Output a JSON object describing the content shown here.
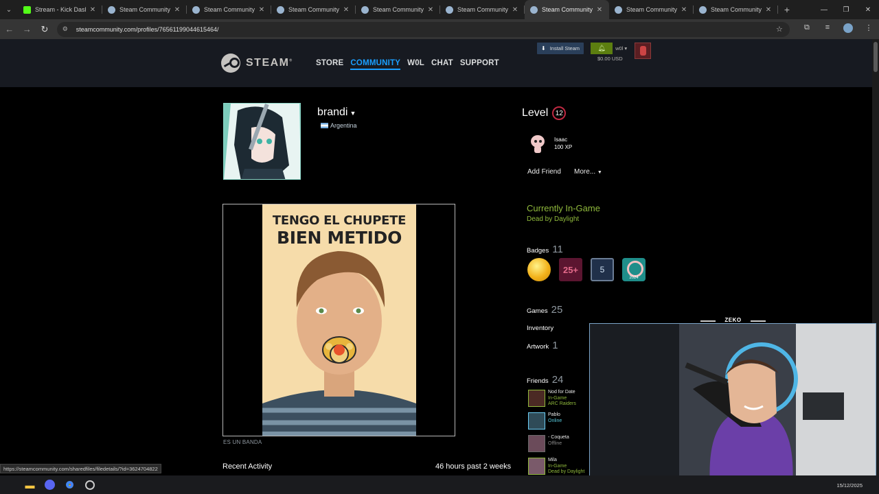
{
  "browser": {
    "tabs": [
      {
        "title": "Stream - Kick Dashbo",
        "icon": "kick-icon"
      },
      {
        "title": "Steam Community ::",
        "icon": "steam-icon"
      },
      {
        "title": "Steam Community ::",
        "icon": "steam-icon"
      },
      {
        "title": "Steam Community ::",
        "icon": "steam-icon"
      },
      {
        "title": "Steam Community ::",
        "icon": "steam-icon"
      },
      {
        "title": "Steam Community ::",
        "icon": "steam-icon"
      },
      {
        "title": "Steam Community ::",
        "icon": "steam-icon",
        "active": true
      },
      {
        "title": "Steam Community ::",
        "icon": "steam-icon"
      },
      {
        "title": "Steam Community ::",
        "icon": "steam-icon"
      }
    ],
    "url": "steamcommunity.com/profiles/76561199044615464/",
    "status_url": "https://steamcommunity.com/sharedfiles/filedetails/?id=3624704822"
  },
  "steam_header": {
    "logo_text": "STEAM",
    "nav": [
      "STORE",
      "COMMUNITY",
      "W0L",
      "CHAT",
      "SUPPORT"
    ],
    "active_nav": "COMMUNITY",
    "install_label": "Install Steam",
    "account_name": "w0l",
    "wallet": "$0.00 USD"
  },
  "profile": {
    "persona_name": "brandi",
    "country": "Argentina",
    "level_label": "Level",
    "level": "12",
    "favorite_badge": {
      "name": "Isaac",
      "xp": "100 XP"
    },
    "add_friend_label": "Add Friend",
    "more_label": "More...",
    "showcase": {
      "poster_line1": "TENGO EL CHUPETE",
      "poster_line2": "BIEN METIDO",
      "caption": "ES UN BANDA"
    },
    "status_title": "Currently In-Game",
    "status_game": "Dead by Daylight",
    "badges_label": "Badges",
    "badges_count": "11",
    "badge_icons": [
      "25+",
      "5",
      "2024"
    ],
    "games_label": "Games",
    "games_count": "25",
    "inventory_label": "Inventory",
    "artwork_label": "Artwork",
    "artwork_count": "1",
    "friends_label": "Friends",
    "friends_count": "24",
    "friends": [
      {
        "name": "Nod for Date",
        "status": "In-Game",
        "game": "ARC Raiders",
        "state": "ingame"
      },
      {
        "name": "Pablo",
        "status": "Online",
        "game": "",
        "state": "online"
      },
      {
        "name": "- Coqueta",
        "status": "Offline",
        "game": "",
        "state": "offline"
      },
      {
        "name": "Mila",
        "status": "In-Game",
        "game": "Dead by Daylight",
        "state": "ingame"
      }
    ],
    "recent_activity_label": "Recent Activity",
    "recent_hours": "46 hours past 2 weeks"
  },
  "overlay": {
    "cam_label": "ZEKO"
  },
  "taskbar": {
    "date": "15/12/2025"
  },
  "colors": {
    "steam_blue": "#1a9fff",
    "ingame_green": "#90ba3c",
    "online_blue": "#57cbde",
    "level_red": "#c02942"
  }
}
